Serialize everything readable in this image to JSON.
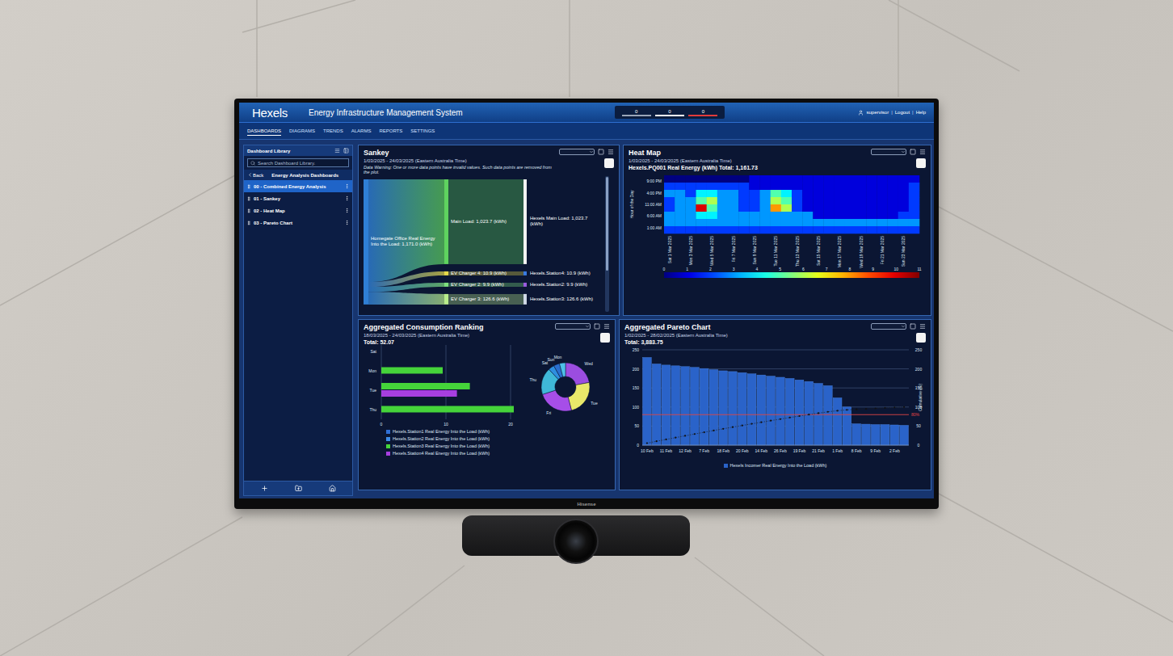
{
  "app": {
    "logo": "Hexels",
    "title": "Energy Infrastructure Management System",
    "header_links": [
      "supervisor",
      "Logout",
      "Help"
    ],
    "separator": "|"
  },
  "alarm_counters": [
    {
      "value": "0",
      "color": "#9aa6b8"
    },
    {
      "value": "0",
      "color": "#ffffff"
    },
    {
      "value": "0",
      "color": "#e23b3b"
    }
  ],
  "nav": [
    {
      "label": "DASHBOARDS",
      "selected": true
    },
    {
      "label": "DIAGRAMS",
      "selected": false
    },
    {
      "label": "TRENDS",
      "selected": false
    },
    {
      "label": "ALARMS",
      "selected": false
    },
    {
      "label": "REPORTS",
      "selected": false
    },
    {
      "label": "SETTINGS",
      "selected": false
    }
  ],
  "sidebar": {
    "title": "Dashboard Library",
    "search_placeholder": "Search Dashboard Library.",
    "back": "Back",
    "folder": "Energy Analysis Dashboards",
    "items": [
      {
        "label": "00 - Combined Energy Analysis",
        "selected": true
      },
      {
        "label": "01 - Sankey",
        "selected": false
      },
      {
        "label": "02 - Heat Map",
        "selected": false
      },
      {
        "label": "03 - Pareto Chart",
        "selected": false
      }
    ]
  },
  "sankey": {
    "title": "Sankey",
    "range": "1/03/2025 - 24/03/2025 (Eastern Australia Time)",
    "warning": "Data Warning: One or more data points have invalid values. Such data points are removed from the plot.",
    "source": {
      "label": "Homegate Office Real Energy Into the Load: 1,171.0 (kWh)",
      "value": 1171.0,
      "color": "#2f7fd6"
    },
    "flows": [
      {
        "label": "Main Load: 1,023.7 (kWh)",
        "value": 1023.7,
        "color": "#5fd35f",
        "target": {
          "label": "Hexels Main Load: 1,023.7 (kWh)",
          "color": "#f2f2f2"
        }
      },
      {
        "label": "EV Charger 4: 10.9 (kWh)",
        "value": 10.9,
        "color": "#e6d84a",
        "target": {
          "label": "Hexels.Station4: 10.9 (kWh)",
          "color": "#3a7be0"
        }
      },
      {
        "label": "EV Charger 2: 9.9 (kWh)",
        "value": 9.9,
        "color": "#7ee07e",
        "target": {
          "label": "Hexels.Station2: 9.9 (kWh)",
          "color": "#9a5be0"
        }
      },
      {
        "label": "EV Charger 3: 126.6 (kWh)",
        "value": 126.6,
        "color": "#b9ec8c",
        "target": {
          "label": "Hexels.Station3: 126.6 (kWh)",
          "color": "#cfd8e6"
        }
      }
    ]
  },
  "heat_map": {
    "title": "Heat Map",
    "range": "1/03/2025 - 24/03/2025 (Eastern Australia Time)",
    "series": "Hexels.PQ001 Real Energy (kWh) Total: 1,161.73",
    "y_title": "Hour of the Day",
    "y_ticks": [
      "9:00 PM",
      "4:00 PM",
      "11:00 AM",
      "6:00 AM",
      "1:00 AM"
    ],
    "x_ticks": [
      "Sat 1 Mar 2025",
      "Mon 3 Mar 2025",
      "Wed 5 Mar 2025",
      "Fri 7 Mar 2025",
      "Sun 9 Mar 2025",
      "Tue 11 Mar 2025",
      "Thu 13 Mar 2025",
      "Sat 15 Mar 2025",
      "Mon 17 Mar 2025",
      "Wed 19 Mar 2025",
      "Fri 21 Mar 2025",
      "Sun 23 Mar 2025"
    ],
    "scale": {
      "min": 0,
      "max": 11,
      "ticks": [
        "0",
        "1",
        "2",
        "3",
        "4",
        "5",
        "6",
        "7",
        "8",
        "9",
        "10",
        "11"
      ]
    },
    "rows": [
      [
        0,
        0,
        0,
        0,
        0,
        0,
        0,
        0,
        1,
        1,
        1,
        1,
        1,
        1,
        1,
        1,
        1,
        1,
        1,
        1,
        1,
        1,
        1,
        1
      ],
      [
        2,
        2,
        2,
        2,
        2,
        2,
        2,
        2,
        1,
        1,
        1,
        1,
        1,
        1,
        1,
        1,
        1,
        1,
        1,
        1,
        1,
        1,
        1,
        2
      ],
      [
        3,
        3,
        2,
        4,
        4,
        3,
        3,
        2,
        2,
        3,
        5,
        4,
        2,
        1,
        1,
        1,
        1,
        1,
        1,
        1,
        1,
        1,
        1,
        2
      ],
      [
        2,
        3,
        3,
        5,
        6,
        3,
        3,
        2,
        2,
        3,
        6,
        5,
        2,
        1,
        1,
        1,
        1,
        1,
        1,
        1,
        1,
        1,
        1,
        2
      ],
      [
        2,
        3,
        3,
        10,
        5,
        3,
        3,
        2,
        2,
        3,
        8,
        6,
        2,
        1,
        1,
        1,
        1,
        1,
        1,
        1,
        1,
        1,
        1,
        2
      ],
      [
        3,
        3,
        3,
        4,
        4,
        3,
        3,
        3,
        3,
        3,
        3,
        3,
        3,
        3,
        1,
        1,
        1,
        1,
        1,
        1,
        1,
        1,
        2,
        2
      ],
      [
        3,
        3,
        3,
        3,
        3,
        3,
        3,
        3,
        3,
        3,
        3,
        3,
        3,
        3,
        3,
        3,
        3,
        3,
        3,
        3,
        3,
        3,
        3,
        3
      ],
      [
        2,
        2,
        2,
        2,
        2,
        2,
        2,
        2,
        2,
        2,
        2,
        2,
        2,
        2,
        2,
        2,
        2,
        2,
        2,
        2,
        2,
        2,
        2,
        2
      ]
    ]
  },
  "ranking": {
    "title": "Aggregated Consumption Ranking",
    "range": "18/03/2025 - 24/03/2025 (Eastern Australia Time)",
    "total": "Total: 52.07",
    "categories": [
      "Sat",
      "Mon",
      "Tue",
      "Thu"
    ],
    "x_ticks": [
      {
        "label": "0",
        "value": 0
      },
      {
        "label": "10",
        "value": 10
      },
      {
        "label": "20",
        "value": 20
      }
    ],
    "x_max": 25,
    "series": [
      {
        "name": "Hexels.Station1 Real Energy Into the Load (kWh)",
        "color": "#2f6fd6",
        "values": [
          0,
          0,
          0,
          0
        ]
      },
      {
        "name": "Hexels.Station2 Real Energy Into the Load (kWh)",
        "color": "#3d8be8",
        "values": [
          0,
          0,
          0,
          0
        ]
      },
      {
        "name": "Hexels.Station3 Real Energy Into the Load (kWh)",
        "color": "#45d43a",
        "values": [
          0,
          9.5,
          13.7,
          20.5
        ]
      },
      {
        "name": "Hexels.Station4 Real Energy Into the Load (kWh)",
        "color": "#a63fe0",
        "values": [
          0,
          0,
          11.7,
          0
        ]
      }
    ],
    "donut": [
      {
        "label": "Wed",
        "value": 0.22,
        "color": "#9b4de0"
      },
      {
        "label": "Tue",
        "value": 0.24,
        "color": "#e8e86a"
      },
      {
        "label": "Fri",
        "value": 0.24,
        "color": "#a64ee8"
      },
      {
        "label": "Thu",
        "value": 0.18,
        "color": "#3fb8d8"
      },
      {
        "label": "Sat",
        "value": 0.04,
        "color": "#2e8fe0"
      },
      {
        "label": "Sun",
        "value": 0.04,
        "color": "#2a6fd0"
      },
      {
        "label": "Mon",
        "value": 0.04,
        "color": "#4ec0e8"
      }
    ]
  },
  "pareto": {
    "title": "Aggregated Pareto Chart",
    "range": "1/02/2025 - 28/02/2025 (Eastern Australia Time)",
    "total": "Total: 3,883.75",
    "y_ticks": [
      {
        "label": "0",
        "value": 0
      },
      {
        "label": "50",
        "value": 50
      },
      {
        "label": "100",
        "value": 100
      },
      {
        "label": "150",
        "value": 150
      },
      {
        "label": "200",
        "value": 200
      },
      {
        "label": "250",
        "value": 250
      }
    ],
    "y2_ticks": [
      {
        "label": "0",
        "value": 0
      },
      {
        "label": "50",
        "value": 50
      },
      {
        "label": "100",
        "value": 100
      },
      {
        "label": "150",
        "value": 150
      },
      {
        "label": "200",
        "value": 200
      },
      {
        "label": "250",
        "value": 250
      }
    ],
    "y2_title": "Cumulative (%)",
    "threshold": {
      "label": "80%",
      "value": 80,
      "color": "#e04646"
    },
    "x_labels": [
      "10 Feb",
      "11 Feb",
      "12 Feb",
      "7 Feb",
      "18 Feb",
      "20 Feb",
      "14 Feb",
      "26 Feb",
      "19 Feb",
      "21 Feb",
      "1 Feb",
      "8 Feb",
      "9 Feb",
      "2 Feb"
    ],
    "values": [
      230,
      213,
      210,
      208,
      206,
      204,
      201,
      198,
      195,
      193,
      190,
      187,
      184,
      181,
      178,
      175,
      171,
      167,
      162,
      156,
      124,
      100,
      56,
      55,
      54,
      54,
      53,
      52
    ],
    "bar_color": "#2a63c9",
    "series": "Hexels Incomer Real Energy Into the Load (kWh)"
  },
  "tv": {
    "brand": "Hisense"
  }
}
